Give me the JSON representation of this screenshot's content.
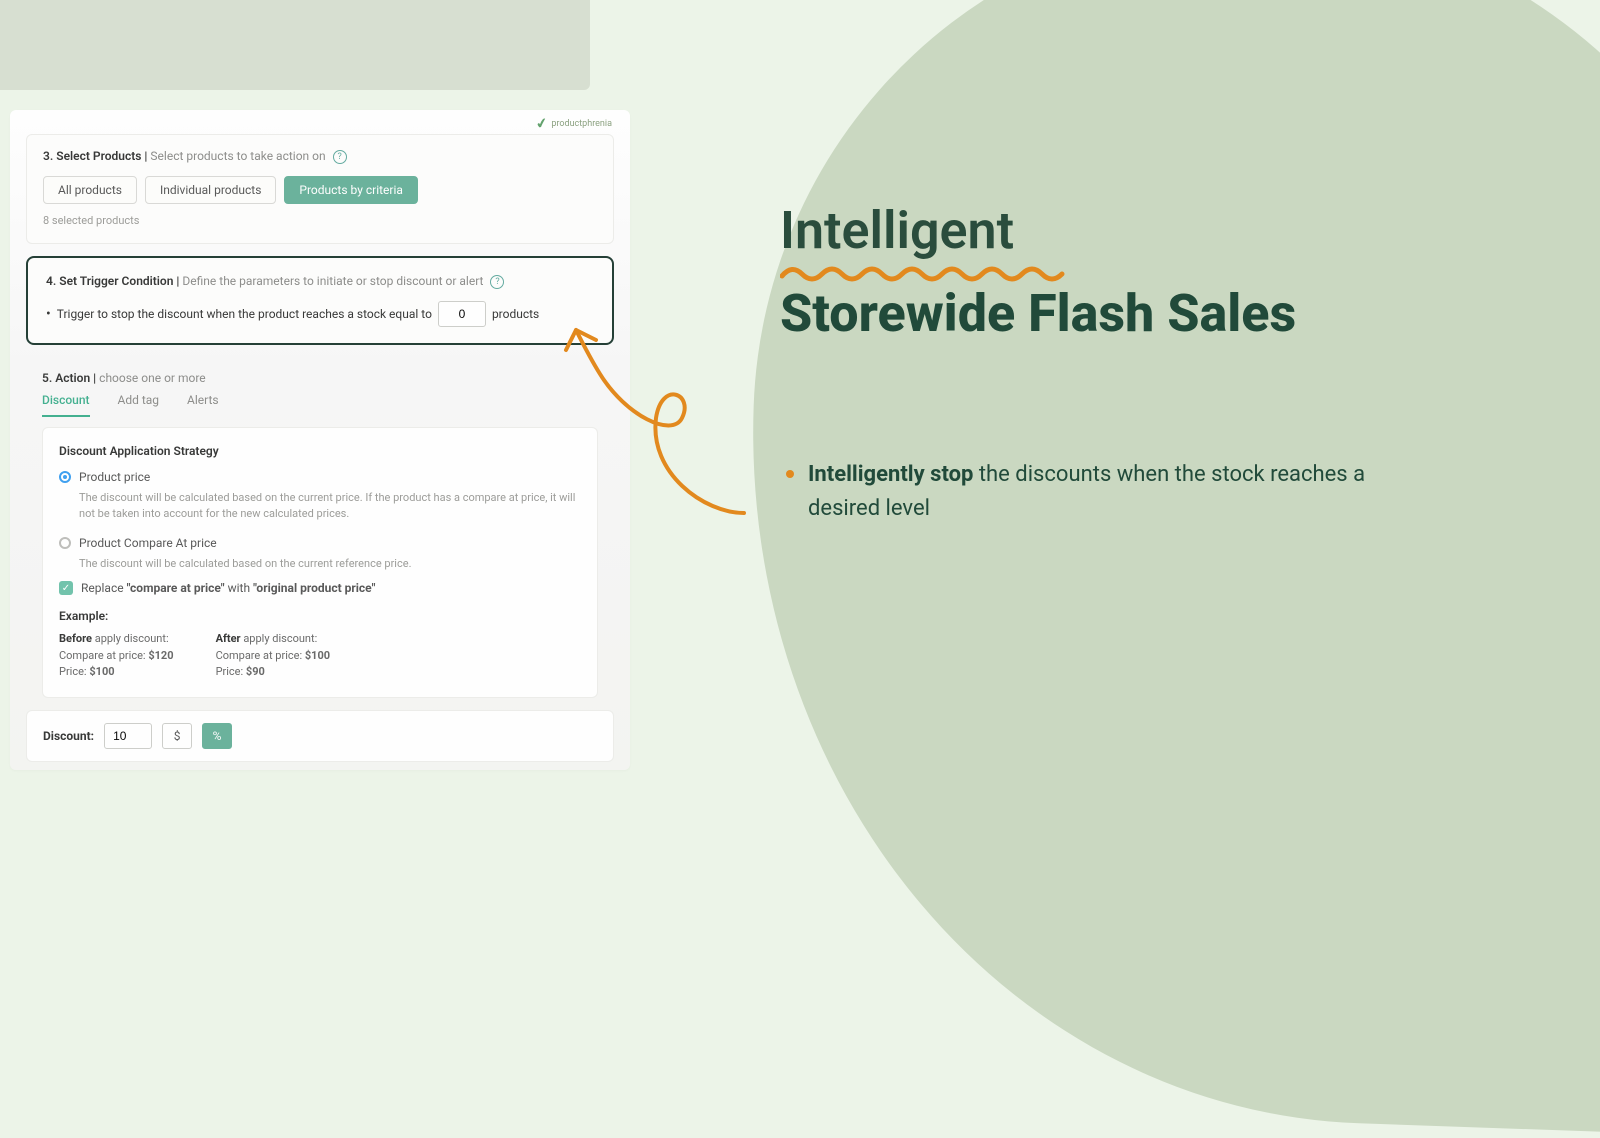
{
  "brand": "productphrenia",
  "step3": {
    "heading": "3. Select Products",
    "sub": "Select products to take action on",
    "buttons": {
      "all": "All products",
      "individual": "Individual products",
      "criteria": "Products by criteria"
    },
    "selected_text": "8 selected products"
  },
  "step4": {
    "heading": "4. Set Trigger Condition",
    "sub": "Define the parameters to initiate or stop discount or alert",
    "trigger_prefix": "Trigger to stop the discount when the product reaches a stock equal to",
    "trigger_value": "0",
    "trigger_suffix": "products"
  },
  "step5": {
    "heading": "5. Action",
    "sub": "choose one or more",
    "tabs": {
      "discount": "Discount",
      "addtag": "Add tag",
      "alerts": "Alerts"
    },
    "strategy_title": "Discount Application Strategy",
    "opt1_label": "Product price",
    "opt1_desc": "The discount will be calculated based on the current price. If the product has a compare at price, it will not be taken into account for the new calculated prices.",
    "opt2_label": "Product Compare At price",
    "opt2_desc": "The discount will be calculated based on the current reference price.",
    "replace_prefix": "Replace ",
    "replace_q1": "\"compare at price\"",
    "replace_mid": " with ",
    "replace_q2": "\"original product price\"",
    "example_label": "Example:",
    "before_hd": "Before",
    "after_hd": "After",
    "apply_text": " apply discount:",
    "compare_at_label": "Compare at price: ",
    "price_label": "Price: ",
    "before_compare": "$120",
    "before_price": "$100",
    "after_compare": "$100",
    "after_price": "$90"
  },
  "discount_bar": {
    "label": "Discount:",
    "value": "10",
    "dollar": "$",
    "percent": "%"
  },
  "headline": {
    "line1": "Intelligent",
    "line2": "Storewide Flash Sales"
  },
  "callout": {
    "bold": "Intelligently stop",
    "rest": " the discounts when the stock reaches a desired level"
  }
}
